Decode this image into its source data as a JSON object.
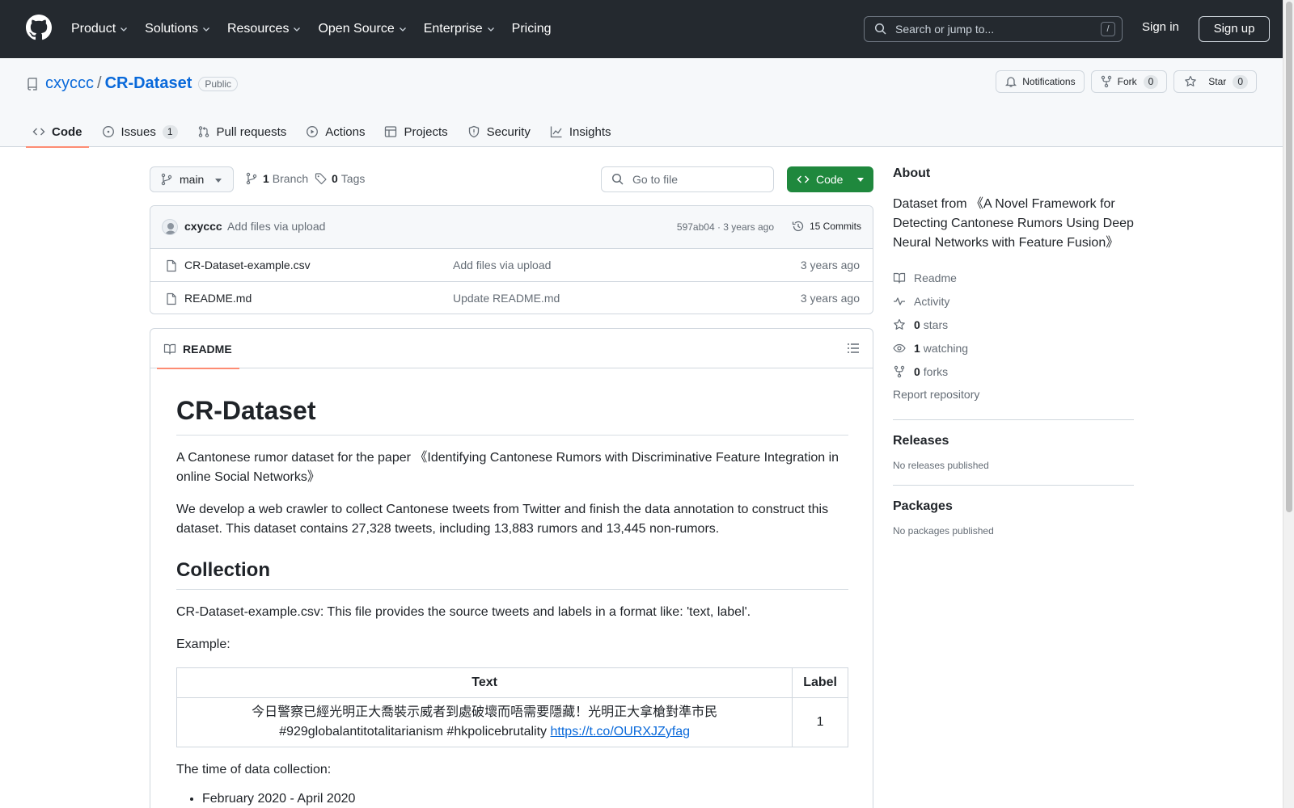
{
  "header": {
    "nav": [
      {
        "label": "Product"
      },
      {
        "label": "Solutions"
      },
      {
        "label": "Resources"
      },
      {
        "label": "Open Source"
      },
      {
        "label": "Enterprise"
      },
      {
        "label": "Pricing"
      }
    ],
    "search_placeholder": "Search or jump to...",
    "search_shortcut": "/",
    "sign_in": "Sign in",
    "sign_up": "Sign up"
  },
  "repo": {
    "owner": "cxyccc",
    "separator": "/",
    "name": "CR-Dataset",
    "visibility": "Public",
    "notifications": "Notifications",
    "fork_label": "Fork",
    "fork_count": "0",
    "star_label": "Star",
    "star_count": "0"
  },
  "repo_nav": {
    "code": "Code",
    "issues": "Issues",
    "issues_count": "1",
    "pulls": "Pull requests",
    "actions": "Actions",
    "projects": "Projects",
    "security": "Security",
    "insights": "Insights"
  },
  "toolbar": {
    "branch": "main",
    "branch_count": "1",
    "branch_label": "Branch",
    "tag_count": "0",
    "tag_label": "Tags",
    "goto_file": "Go to file",
    "code_button": "Code"
  },
  "commit": {
    "author": "cxyccc",
    "message": "Add files via upload",
    "meta": "597ab04 · 3 years ago",
    "commits": "15 Commits"
  },
  "files": [
    {
      "name": "CR-Dataset-example.csv",
      "message": "Add files via upload",
      "date": "3 years ago"
    },
    {
      "name": "README.md",
      "message": "Update README.md",
      "date": "3 years ago"
    }
  ],
  "readme": {
    "tab": "README",
    "title": "CR-Dataset",
    "p1": "A Cantonese rumor dataset for the paper 《Identifying Cantonese Rumors with Discriminative Feature Integration in online Social Networks》",
    "p2": "We develop a web crawler to collect Cantonese tweets from Twitter and finish the data annotation to construct this dataset. This dataset contains 27,328 tweets, including 13,883 rumors and 13,445 non-rumors.",
    "h_collection": "Collection",
    "p3": "CR-Dataset-example.csv: This file provides the source tweets and labels in a format like: 'text, label'.",
    "p4": "Example:",
    "table": {
      "headers": [
        "Text",
        "Label"
      ],
      "row_text": "今日警察已經光明正大喬裝示威者到處破壞而唔需要隱藏！光明正大拿槍對準市民 #929globalantitotalitarianism #hkpolicebrutality ",
      "row_link": "https://t.co/OURXJZyfag",
      "row_label": "1"
    },
    "p5": "The time of data collection:",
    "list": [
      "February 2020 - April 2020"
    ]
  },
  "sidebar": {
    "about": "About",
    "description": "Dataset from 《A Novel Framework for Detecting Cantonese Rumors Using Deep Neural Networks with Feature Fusion》",
    "readme": "Readme",
    "activity": "Activity",
    "stars_count": "0",
    "stars_label": "stars",
    "watching_count": "1",
    "watching_label": "watching",
    "forks_count": "0",
    "forks_label": "forks",
    "report": "Report repository",
    "releases": "Releases",
    "releases_empty": "No releases published",
    "packages": "Packages",
    "packages_empty": "No packages published"
  },
  "colors": {
    "header_bg": "#24292f",
    "accent_link": "#0969da",
    "primary_button": "#1f883d",
    "active_tab_underline": "#fd8c73"
  },
  "icons": [
    "github-logo-icon",
    "chevron-down-icon",
    "search-icon",
    "repo-icon",
    "bell-icon",
    "fork-icon",
    "star-icon",
    "code-icon",
    "issue-icon",
    "pull-request-icon",
    "play-icon",
    "table-icon",
    "shield-icon",
    "graph-icon",
    "branch-icon",
    "tag-icon",
    "history-icon",
    "file-icon",
    "book-icon",
    "list-icon",
    "pulse-icon",
    "eye-icon"
  ]
}
